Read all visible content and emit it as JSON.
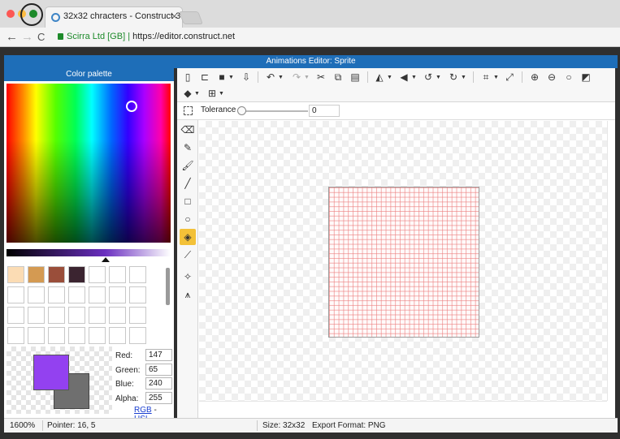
{
  "browser": {
    "tab_title": "32x32 chracters - Construct 3",
    "tab_close": "×",
    "back": "←",
    "forward": "→",
    "reload": "C",
    "site_identity": "Scirra Ltd [GB]",
    "url": "https://editor.construct.net"
  },
  "window": {
    "title": "Animations Editor: Sprite"
  },
  "palette": {
    "title": "Color palette",
    "swatches": [
      "#fbdcb4",
      "#d49a52",
      "#9a4e3a",
      "#3b2430",
      "",
      "",
      "",
      "",
      "",
      "",
      "",
      "",
      "",
      "",
      "",
      "",
      "",
      "",
      "",
      "",
      "",
      "",
      "",
      "",
      "",
      "",
      "",
      ""
    ],
    "primary_color": "#9341f0",
    "secondary_color": "#6f6f6f",
    "red_label": "Red:",
    "red": "147",
    "green_label": "Green:",
    "green": "65",
    "blue_label": "Blue:",
    "blue": "240",
    "alpha_label": "Alpha:",
    "alpha": "255",
    "mode_rgb": "RGB",
    "mode_sep": "-",
    "mode_hsl": "HSL"
  },
  "toolbar": {
    "icons": [
      "new-frame-icon",
      "open-icon",
      "save-icon",
      "export-icon",
      "undo-icon",
      "redo-icon",
      "cut-icon",
      "copy-icon",
      "paste-icon",
      "flip-horizontal-icon",
      "flip-vertical-icon",
      "rotate-ccw-icon",
      "rotate-cw-icon",
      "crop-icon",
      "resize-icon",
      "zoom-in-icon",
      "zoom-out-icon",
      "zoom-reset-icon",
      "toggle-background-icon",
      "layers-icon",
      "grid-icon"
    ]
  },
  "options": {
    "tolerance_label": "Tolerance",
    "tolerance_value": "0"
  },
  "tools": [
    "eraser-icon",
    "pencil-icon",
    "brush-icon",
    "line-icon",
    "rectangle-icon",
    "ellipse-icon",
    "fill-icon",
    "color-picker-icon",
    "set-origin-icon",
    "image-points-icon"
  ],
  "active_tool": "fill-icon",
  "status": {
    "zoom": "1600%",
    "pointer": "Pointer: 16, 5",
    "size": "Size: 32x32",
    "export_format": "Export Format: PNG"
  }
}
